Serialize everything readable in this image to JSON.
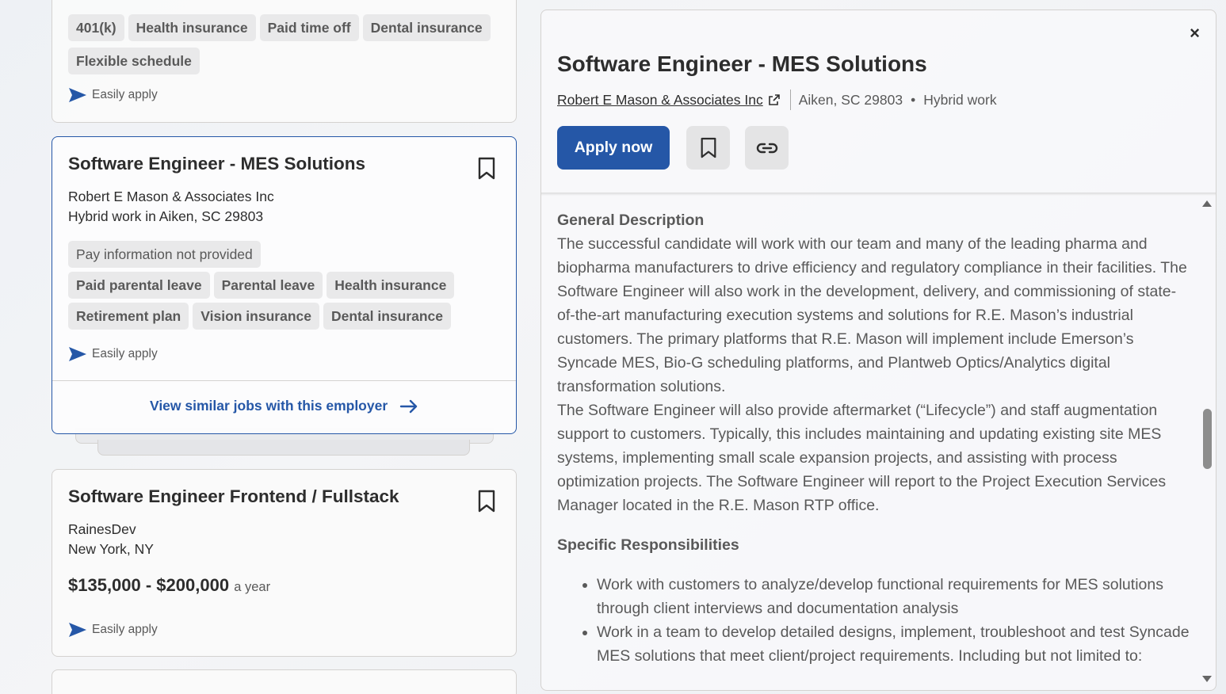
{
  "top_card": {
    "tags_row1": [
      "401(k)",
      "Health insurance",
      "Paid time off",
      "Dental insurance"
    ],
    "tags_row2": [
      "Flexible schedule"
    ],
    "easily_apply": "Easily apply"
  },
  "selected_card": {
    "title": "Software Engineer - MES Solutions",
    "company": "Robert E Mason & Associates Inc",
    "location": "Hybrid work in Aiken, SC 29803",
    "pay": "Pay information not provided",
    "tags": [
      "Paid parental leave",
      "Parental leave",
      "Health insurance",
      "Retirement plan",
      "Vision insurance",
      "Dental insurance"
    ],
    "easily_apply": "Easily apply",
    "similar_link": "View similar jobs with this employer"
  },
  "third_card": {
    "title": "Software Engineer Frontend / Fullstack",
    "company": "RainesDev",
    "location": "New York, NY",
    "salary": "$135,000 - $200,000",
    "salary_period": "a year",
    "easily_apply": "Easily apply"
  },
  "detail": {
    "close_label": "×",
    "title": "Software Engineer - MES Solutions",
    "company": "Robert E Mason & Associates Inc",
    "location": "Aiken, SC 29803",
    "dot": "•",
    "work_type": "Hybrid work",
    "apply_label": "Apply now",
    "general_heading": "General Description",
    "general_p1": "The successful candidate will work with our team and many of the leading pharma and biopharma manufacturers to drive efficiency and regulatory compliance in their facilities. The Software Engineer will also work in the development, delivery, and commissioning of state-of-the-art manufacturing execution systems and solutions for R.E. Mason’s industrial customers. The primary platforms that R.E. Mason will implement include Emerson’s Syncade MES, Bio-G scheduling platforms, and Plantweb Optics/Analytics digital transformation solutions.",
    "general_p2": "The Software Engineer will also provide aftermarket (“Lifecycle”) and staff augmentation support to customers. Typically, this includes maintaining and updating existing site MES systems, implementing small scale expansion projects, and assisting with process optimization projects. The Software Engineer will report to the Project Execution Services Manager located in the R.E. Mason RTP office.",
    "resp_heading": "Specific Responsibilities",
    "resp_items": [
      "Work with customers to analyze/develop functional requirements for MES solutions through client interviews and documentation analysis",
      "Work in a team to develop detailed designs, implement, troubleshoot and test Syncade MES solutions that meet client/project requirements. Including but not limited to:"
    ]
  },
  "colors": {
    "accent": "#2557a7",
    "text": "#2d2d2d",
    "muted": "#595959",
    "tag_bg": "#e9e9ea"
  }
}
